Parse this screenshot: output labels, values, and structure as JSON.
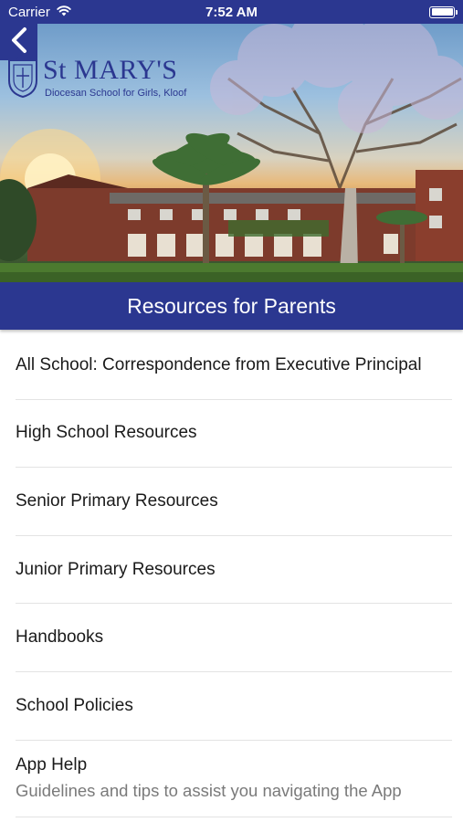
{
  "status_bar": {
    "carrier": "Carrier",
    "time": "7:52 AM",
    "wifi_icon": "wifi-icon",
    "battery_icon": "battery-icon"
  },
  "header": {
    "back_icon": "chevron-left-icon",
    "logo": {
      "title": "St MARY'S",
      "subtitle": "Diocesan School for Girls, Kloof"
    }
  },
  "banner": {
    "title": "Resources for Parents"
  },
  "list": {
    "items": [
      {
        "title": "All School: Correspondence from Executive Principal"
      },
      {
        "title": "High School Resources"
      },
      {
        "title": "Senior Primary Resources"
      },
      {
        "title": "Junior Primary Resources"
      },
      {
        "title": "Handbooks"
      },
      {
        "title": "School Policies"
      },
      {
        "title": "App Help",
        "subtitle": "Guidelines and tips to assist you navigating the App"
      }
    ]
  },
  "colors": {
    "brand": "#2b3790",
    "text": "#1a1a1a",
    "subtext": "#7a7a7a",
    "divider": "#e3e3e3"
  }
}
